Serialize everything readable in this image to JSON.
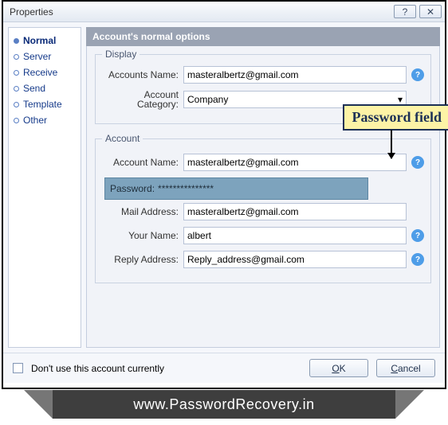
{
  "window": {
    "title": "Properties"
  },
  "sidebar": {
    "items": [
      {
        "label": "Normal",
        "active": true
      },
      {
        "label": "Server"
      },
      {
        "label": "Receive"
      },
      {
        "label": "Send"
      },
      {
        "label": "Template"
      },
      {
        "label": "Other"
      }
    ]
  },
  "main": {
    "heading": "Account's normal options",
    "display_group": {
      "title": "Display",
      "accounts_name_label": "Accounts Name:",
      "accounts_name_value": "masteralbertz@gmail.com",
      "account_category_label": "Account Category:",
      "account_category_value": "Company"
    },
    "account_group": {
      "title": "Account",
      "account_name_label": "Account Name:",
      "account_name_value": "masteralbertz@gmail.com",
      "password_label": "Password:",
      "password_value": "***************",
      "mail_address_label": "Mail Address:",
      "mail_address_value": "masteralbertz@gmail.com",
      "your_name_label": "Your Name:",
      "your_name_value": "albert",
      "reply_address_label": "Reply Address:",
      "reply_address_value": "Reply_address@gmail.com"
    }
  },
  "callout": {
    "text": "Password field"
  },
  "footer": {
    "checkbox_label": "Don't use this account currently",
    "ok_label": "OK",
    "cancel_label": "Cancel"
  },
  "branding": {
    "url": "www.PasswordRecovery.in"
  },
  "icons": {
    "help": "?",
    "dropdown": "▾",
    "close": "✕",
    "question": "?"
  }
}
